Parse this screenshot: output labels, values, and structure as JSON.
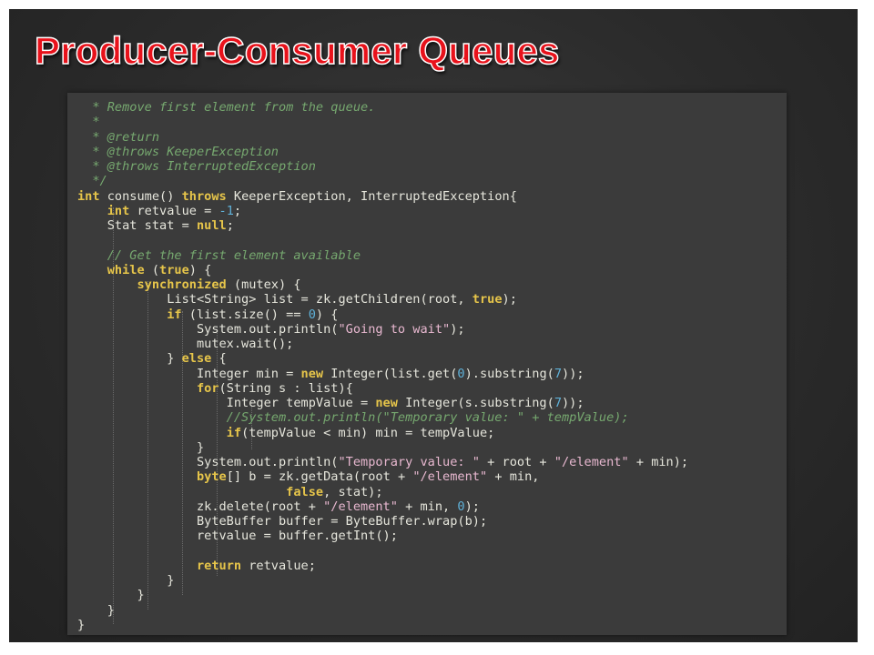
{
  "slide": {
    "title": "Producer-Consumer Queues",
    "colors": {
      "title": "#e8121b",
      "background": "#2b2b2b",
      "code_background": "#3b3b3b"
    }
  },
  "code": {
    "lines": [
      [
        {
          "t": "  * Remove first element from the queue.",
          "c": "cm"
        }
      ],
      [
        {
          "t": "  *",
          "c": "cm"
        }
      ],
      [
        {
          "t": "  * @return",
          "c": "cm"
        }
      ],
      [
        {
          "t": "  * @throws KeeperException",
          "c": "cm"
        }
      ],
      [
        {
          "t": "  * @throws InterruptedException",
          "c": "cm"
        }
      ],
      [
        {
          "t": "  */",
          "c": "cm"
        }
      ],
      [
        {
          "t": "int",
          "c": "kw"
        },
        {
          "t": " consume() ",
          "c": ""
        },
        {
          "t": "throws",
          "c": "kw"
        },
        {
          "t": " KeeperException, InterruptedException{",
          "c": ""
        }
      ],
      [
        {
          "t": "    ",
          "c": ""
        },
        {
          "t": "int",
          "c": "kw"
        },
        {
          "t": " retvalue = ",
          "c": ""
        },
        {
          "t": "-1",
          "c": "num"
        },
        {
          "t": ";",
          "c": ""
        }
      ],
      [
        {
          "t": "    Stat stat = ",
          "c": ""
        },
        {
          "t": "null",
          "c": "kw"
        },
        {
          "t": ";",
          "c": ""
        }
      ],
      [
        {
          "t": "",
          "c": ""
        }
      ],
      [
        {
          "t": "    // Get the first element available",
          "c": "cm"
        }
      ],
      [
        {
          "t": "    ",
          "c": ""
        },
        {
          "t": "while",
          "c": "kw"
        },
        {
          "t": " (",
          "c": ""
        },
        {
          "t": "true",
          "c": "kw"
        },
        {
          "t": ") {",
          "c": ""
        }
      ],
      [
        {
          "t": "        ",
          "c": ""
        },
        {
          "t": "synchronized",
          "c": "kw"
        },
        {
          "t": " (mutex) {",
          "c": ""
        }
      ],
      [
        {
          "t": "            List<String> list = zk.getChildren(root, ",
          "c": ""
        },
        {
          "t": "true",
          "c": "kw"
        },
        {
          "t": ");",
          "c": ""
        }
      ],
      [
        {
          "t": "            ",
          "c": ""
        },
        {
          "t": "if",
          "c": "kw"
        },
        {
          "t": " (list.size() == ",
          "c": ""
        },
        {
          "t": "0",
          "c": "num"
        },
        {
          "t": ") {",
          "c": ""
        }
      ],
      [
        {
          "t": "                System.out.println(",
          "c": ""
        },
        {
          "t": "\"Going to wait\"",
          "c": "str"
        },
        {
          "t": ");",
          "c": ""
        }
      ],
      [
        {
          "t": "                mutex.wait();",
          "c": ""
        }
      ],
      [
        {
          "t": "            } ",
          "c": ""
        },
        {
          "t": "else",
          "c": "kw"
        },
        {
          "t": " {",
          "c": ""
        }
      ],
      [
        {
          "t": "                Integer min = ",
          "c": ""
        },
        {
          "t": "new",
          "c": "kw"
        },
        {
          "t": " Integer(list.get(",
          "c": ""
        },
        {
          "t": "0",
          "c": "num"
        },
        {
          "t": ").substring(",
          "c": ""
        },
        {
          "t": "7",
          "c": "num"
        },
        {
          "t": "));",
          "c": ""
        }
      ],
      [
        {
          "t": "                ",
          "c": ""
        },
        {
          "t": "for",
          "c": "kw"
        },
        {
          "t": "(String s : list){",
          "c": ""
        }
      ],
      [
        {
          "t": "                    Integer tempValue = ",
          "c": ""
        },
        {
          "t": "new",
          "c": "kw"
        },
        {
          "t": " Integer(s.substring(",
          "c": ""
        },
        {
          "t": "7",
          "c": "num"
        },
        {
          "t": "));",
          "c": ""
        }
      ],
      [
        {
          "t": "                    //System.out.println(\"Temporary value: \" + tempValue);",
          "c": "cm"
        }
      ],
      [
        {
          "t": "                    ",
          "c": ""
        },
        {
          "t": "if",
          "c": "kw"
        },
        {
          "t": "(tempValue < min) min = tempValue;",
          "c": ""
        }
      ],
      [
        {
          "t": "                }",
          "c": ""
        }
      ],
      [
        {
          "t": "                System.out.println(",
          "c": ""
        },
        {
          "t": "\"Temporary value: \"",
          "c": "str"
        },
        {
          "t": " + root + ",
          "c": ""
        },
        {
          "t": "\"/element\"",
          "c": "str"
        },
        {
          "t": " + min);",
          "c": ""
        }
      ],
      [
        {
          "t": "                ",
          "c": ""
        },
        {
          "t": "byte",
          "c": "kw"
        },
        {
          "t": "[] b = zk.getData(root + ",
          "c": ""
        },
        {
          "t": "\"/element\"",
          "c": "str"
        },
        {
          "t": " + min,",
          "c": ""
        }
      ],
      [
        {
          "t": "                            ",
          "c": ""
        },
        {
          "t": "false",
          "c": "kw"
        },
        {
          "t": ", stat);",
          "c": ""
        }
      ],
      [
        {
          "t": "                zk.delete(root + ",
          "c": ""
        },
        {
          "t": "\"/element\"",
          "c": "str"
        },
        {
          "t": " + min, ",
          "c": ""
        },
        {
          "t": "0",
          "c": "num"
        },
        {
          "t": ");",
          "c": ""
        }
      ],
      [
        {
          "t": "                ByteBuffer buffer = ByteBuffer.wrap(b);",
          "c": ""
        }
      ],
      [
        {
          "t": "                retvalue = buffer.getInt();",
          "c": ""
        }
      ],
      [
        {
          "t": "",
          "c": ""
        }
      ],
      [
        {
          "t": "                ",
          "c": ""
        },
        {
          "t": "return",
          "c": "kw"
        },
        {
          "t": " retvalue;",
          "c": ""
        }
      ],
      [
        {
          "t": "            }",
          "c": ""
        }
      ],
      [
        {
          "t": "        }",
          "c": ""
        }
      ],
      [
        {
          "t": "    }",
          "c": ""
        }
      ],
      [
        {
          "t": "}",
          "c": ""
        }
      ]
    ],
    "colors": {
      "comment": "#76a86f",
      "keyword": "#e6c54a",
      "number": "#5fb1d8",
      "string": "#e8b8d0",
      "text": "#e6e6dc"
    }
  }
}
